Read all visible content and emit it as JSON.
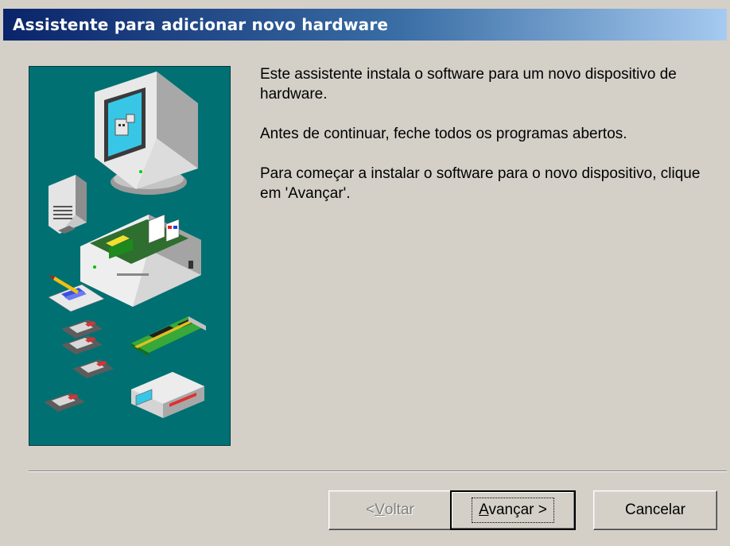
{
  "window": {
    "title": "Assistente para adicionar novo hardware"
  },
  "content": {
    "paragraph1": "Este assistente instala o software para um novo dispositivo de hardware.",
    "paragraph2": "Antes de continuar, feche todos os programas abertos.",
    "paragraph3": "Para começar a instalar o software para o novo dispositivo, clique em 'Avançar'."
  },
  "buttons": {
    "back_prefix": "< ",
    "back_accel": "V",
    "back_rest": "oltar",
    "next_prefix": "",
    "next_accel": "A",
    "next_rest": "vançar >",
    "cancel_label": "Cancelar"
  },
  "colors": {
    "illustration_bg": "#007073",
    "titlebar_start": "#0a246a",
    "titlebar_end": "#a6caf0",
    "dialog_bg": "#d4d0c8"
  },
  "illustration": {
    "icons": [
      "monitor-icon",
      "speaker-icon",
      "computer-case-icon",
      "document-pencil-icon",
      "floppy-disk-icon",
      "expansion-card-icon",
      "modem-icon"
    ]
  }
}
